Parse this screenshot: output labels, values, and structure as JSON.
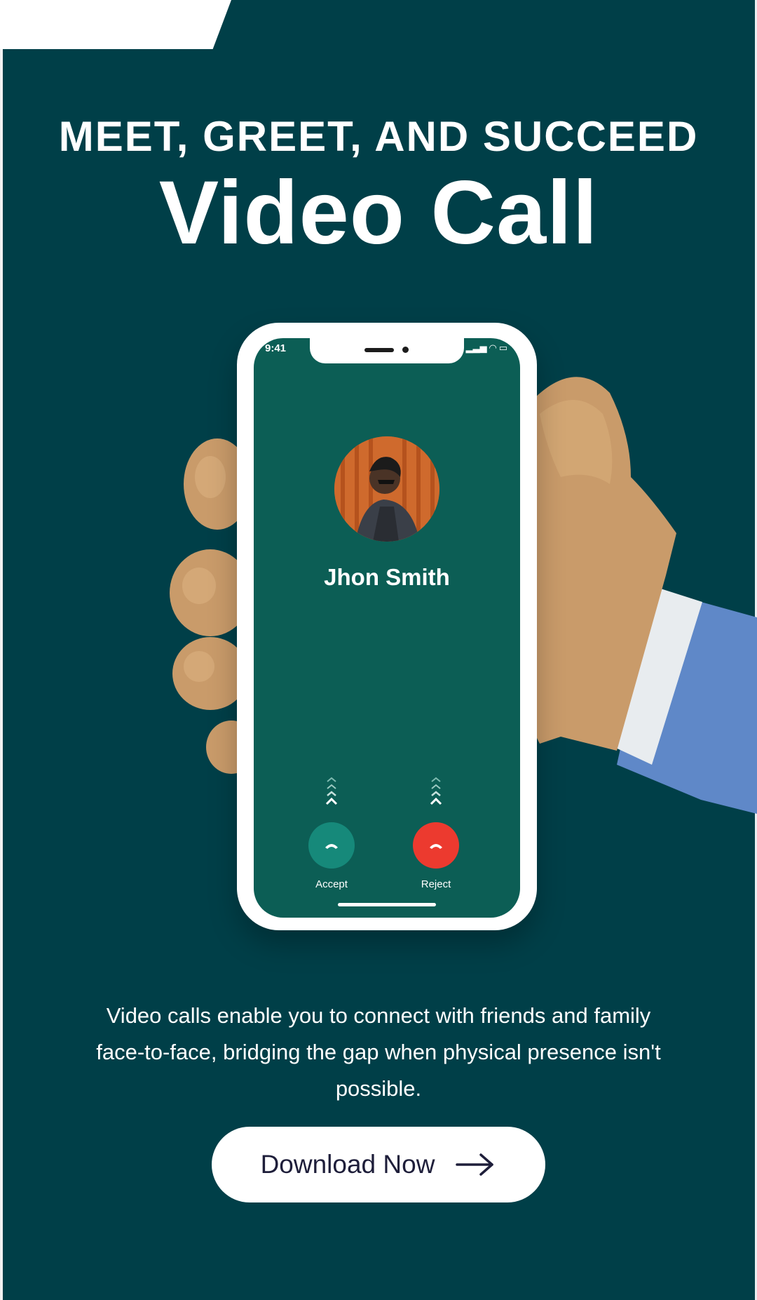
{
  "headline": "MEET, GREET, AND SUCCEED",
  "title": "Video Call",
  "phone": {
    "status_time": "9:41",
    "caller_name": "Jhon Smith",
    "accept_label": "Accept",
    "reject_label": "Reject"
  },
  "description": "Video calls enable you to connect with friends and family face-to-face, bridging the gap when physical presence isn't possible.",
  "cta": {
    "label": "Download Now",
    "icon": "arrow-right-icon"
  },
  "colors": {
    "background": "#003f48",
    "screen": "#0c5e55",
    "accept": "#16897a",
    "reject": "#ec3a2f"
  }
}
